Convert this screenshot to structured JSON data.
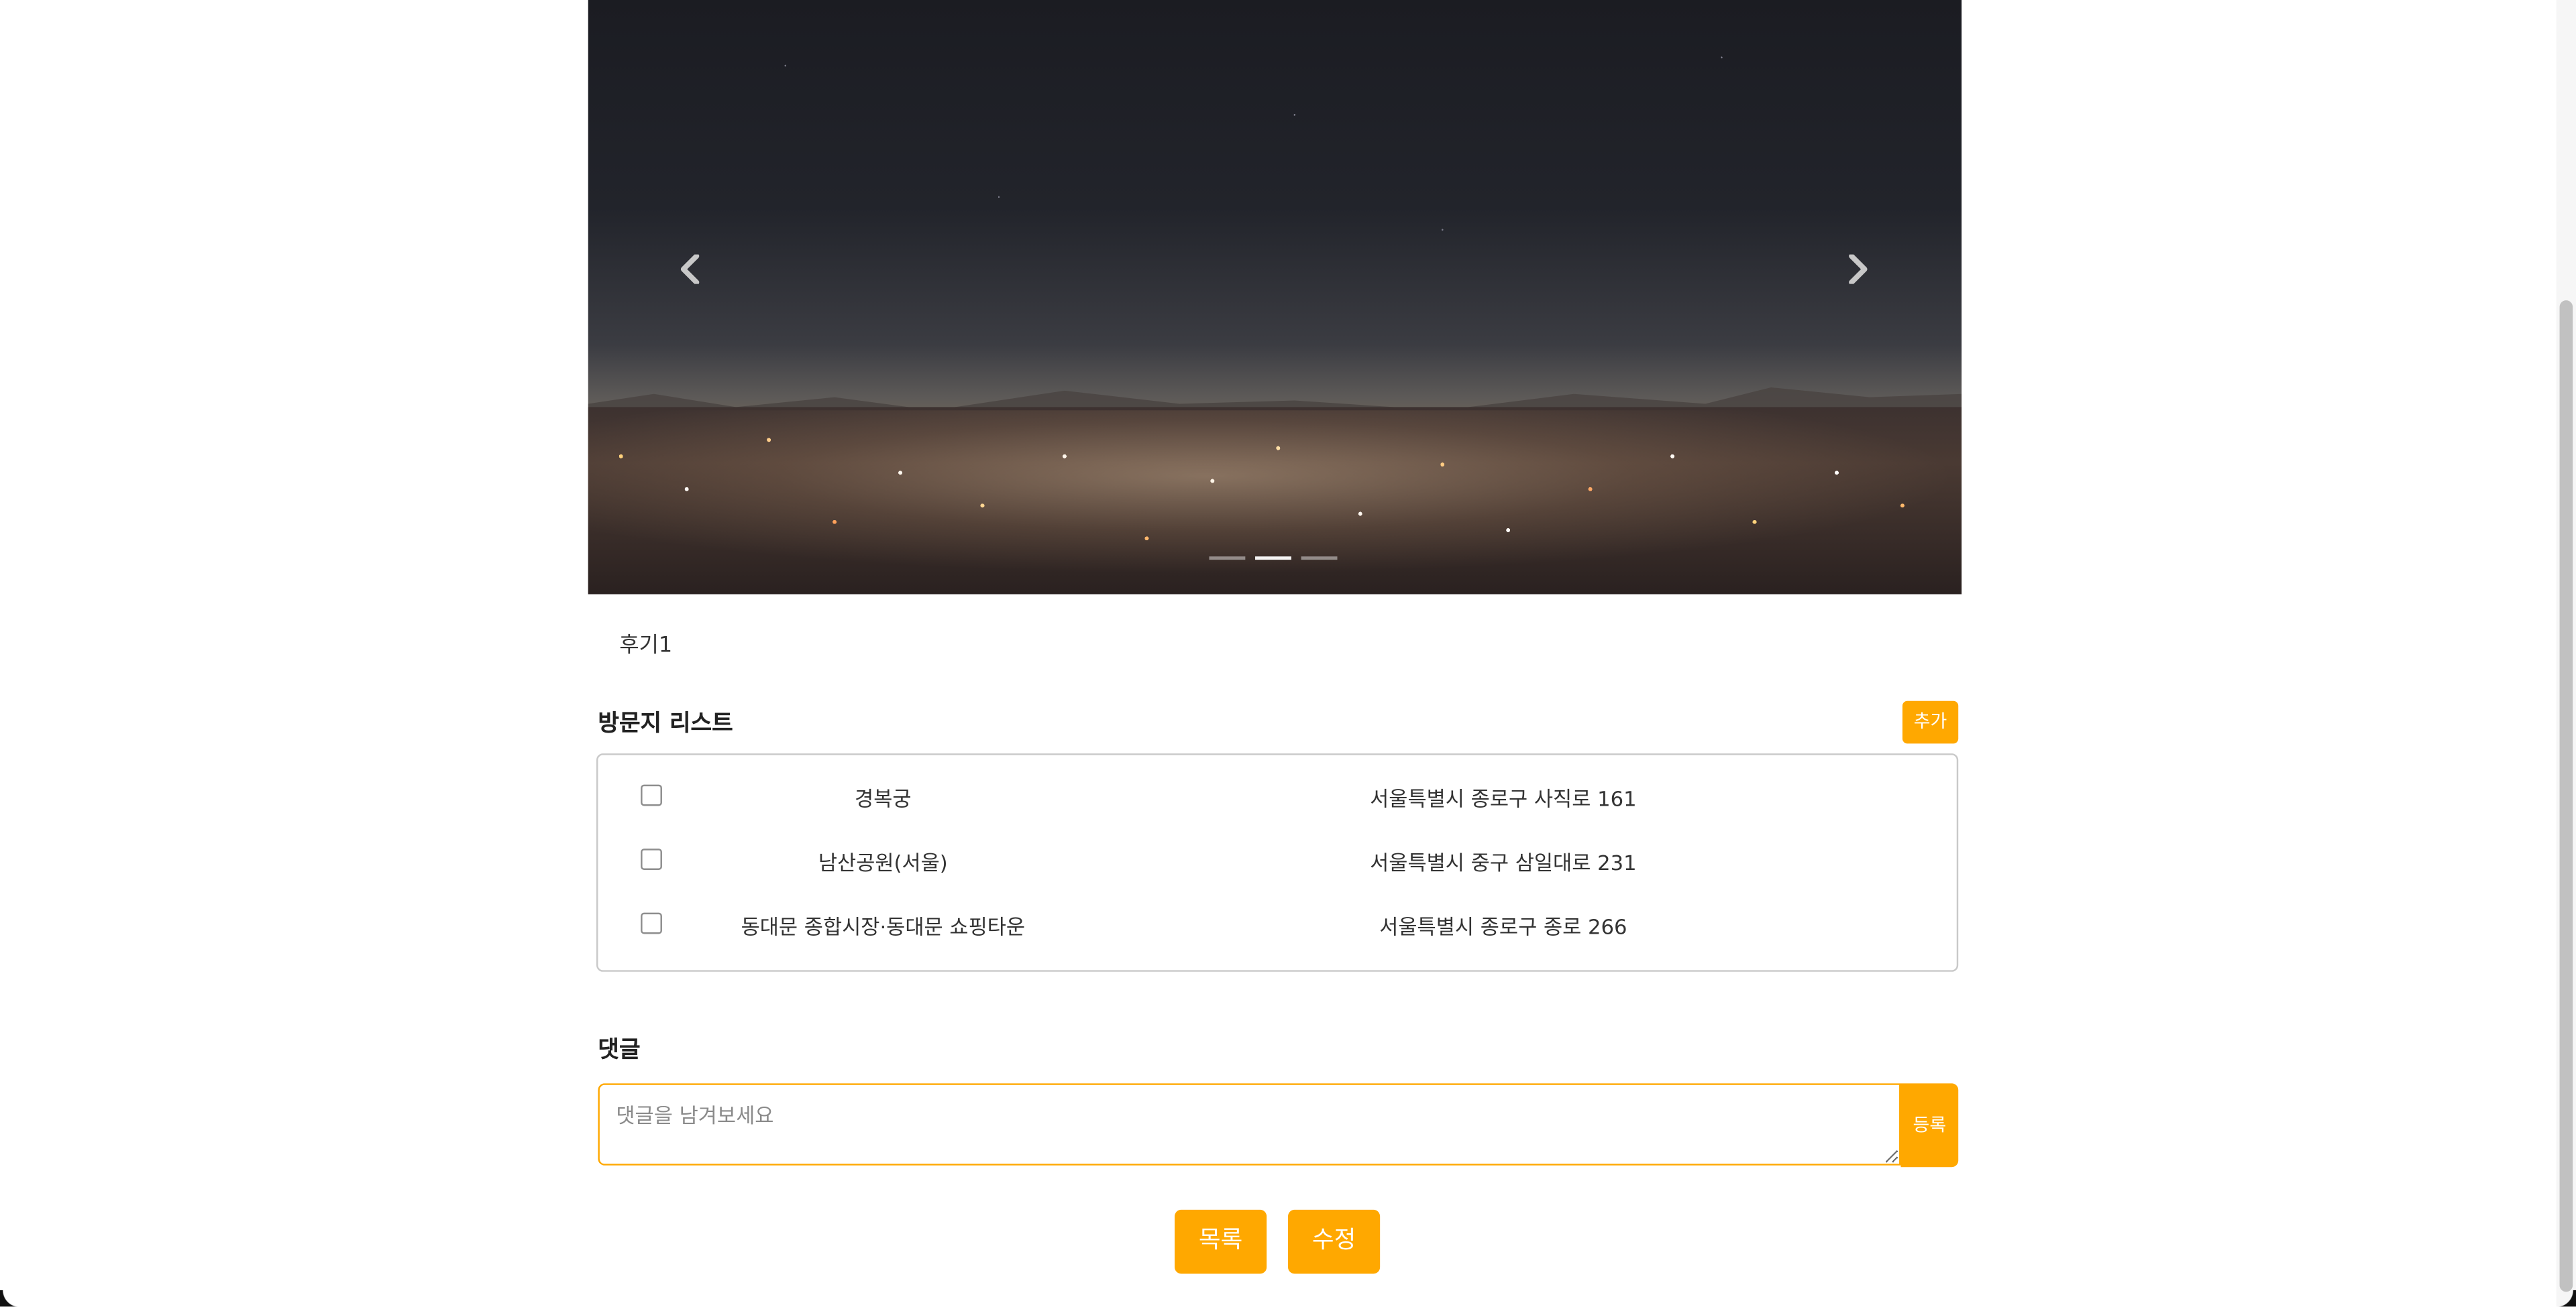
{
  "carousel": {
    "image_alt": "Seoul city night view",
    "prev_icon": "chevron-left-icon",
    "next_icon": "chevron-right-icon",
    "indicator_count": 3,
    "active_indicator": 2
  },
  "post": {
    "title": "후기1"
  },
  "visit_list": {
    "heading": "방문지 리스트",
    "add_label": "추가",
    "items": [
      {
        "name": "경복궁",
        "address": "서울특별시 종로구 사직로 161",
        "checked": false
      },
      {
        "name": "남산공원(서울)",
        "address": "서울특별시 중구 삼일대로 231",
        "checked": false
      },
      {
        "name": "동대문 종합시장·동대문 쇼핑타운",
        "address": "서울특별시 종로구 종로 266",
        "checked": false
      }
    ]
  },
  "comments": {
    "heading": "댓글",
    "placeholder": "댓글을 남겨보세요",
    "value": "",
    "submit_label": "등록"
  },
  "actions": {
    "list_label": "목록",
    "edit_label": "수정"
  },
  "colors": {
    "accent": "#ffa800",
    "border": "#c9c9c9",
    "text": "#333333"
  }
}
